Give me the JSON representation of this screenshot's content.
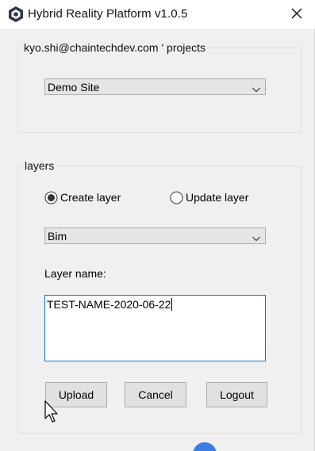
{
  "window": {
    "title": "Hybrid Reality Platform v1.0.5",
    "close_glyph": "✕"
  },
  "projects": {
    "group_label": "kyo.shi@chaintechdev.com ' projects",
    "site_select": {
      "value": "Demo Site"
    }
  },
  "layers": {
    "group_label": "layers",
    "radios": [
      {
        "label": "Create layer",
        "checked": true
      },
      {
        "label": "Update layer",
        "checked": false
      }
    ],
    "type_select": {
      "value": "Bim"
    },
    "layer_name_label": "Layer name:",
    "layer_name_value": "TEST-NAME-2020-06-22"
  },
  "buttons": {
    "upload": "Upload",
    "cancel": "Cancel",
    "logout": "Logout"
  },
  "icons": {
    "app": "app-logo-icon",
    "close": "close-icon",
    "dropdown": "chevron-down-icon",
    "cursor": "mouse-pointer-icon"
  },
  "colors": {
    "window_bg": "#f0f0f0",
    "titlebar_bg": "#ffffff",
    "focus_border": "#0078d7",
    "button_bg": "#e1e1e1",
    "combo_bg": "#e5e5e5"
  }
}
